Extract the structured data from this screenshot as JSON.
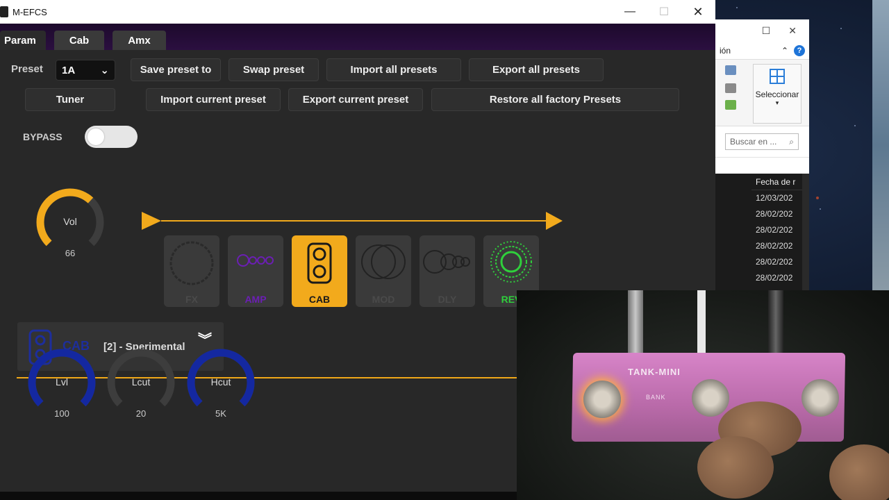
{
  "window": {
    "title": "M-EFCS"
  },
  "tabs": [
    {
      "label": "Param"
    },
    {
      "label": "Cab"
    },
    {
      "label": "Amx"
    }
  ],
  "preset": {
    "label": "Preset",
    "selected": "1A"
  },
  "buttons": {
    "save_preset": "Save preset to",
    "swap_preset": "Swap preset",
    "import_all": "Import all presets",
    "export_all": "Export all presets",
    "tuner": "Tuner",
    "import_current": "Import current preset",
    "export_current": "Export current preset",
    "restore_factory": "Restore all factory Presets"
  },
  "bypass": {
    "label": "BYPASS",
    "on": false
  },
  "volume": {
    "label": "Vol",
    "value": "66",
    "level": 0.66
  },
  "chain": [
    {
      "name": "FX",
      "state": "off"
    },
    {
      "name": "AMP",
      "state": "dim"
    },
    {
      "name": "CAB",
      "state": "active"
    },
    {
      "name": "MOD",
      "state": "off"
    },
    {
      "name": "DLY",
      "state": "off"
    },
    {
      "name": "REV",
      "state": "on"
    }
  ],
  "colors": {
    "accent": "#f2aa1c",
    "amp": "#6b1fb3",
    "rev": "#2fcf3c",
    "knob_blue": "#1428a0",
    "cab_blue": "#1d2e9c"
  },
  "cab_panel": {
    "title": "CAB",
    "model": "[2] - Sperimental"
  },
  "cab_knobs": [
    {
      "label": "Lvl",
      "value": "100",
      "level": 1.0
    },
    {
      "label": "Lcut",
      "value": "20",
      "level": 0.0
    },
    {
      "label": "Hcut",
      "value": "5K",
      "level": 1.0
    }
  ],
  "explorer": {
    "ribbon_fragment": "ión",
    "select_label": "Seleccionar",
    "search_placeholder": "Buscar en ...",
    "date_header": "Fecha de r",
    "dates": [
      "12/03/202",
      "28/02/202",
      "28/02/202",
      "28/02/202",
      "28/02/202",
      "28/02/202"
    ]
  },
  "video": {
    "brand": "TANK-MINI",
    "bank_label": "BANK"
  }
}
